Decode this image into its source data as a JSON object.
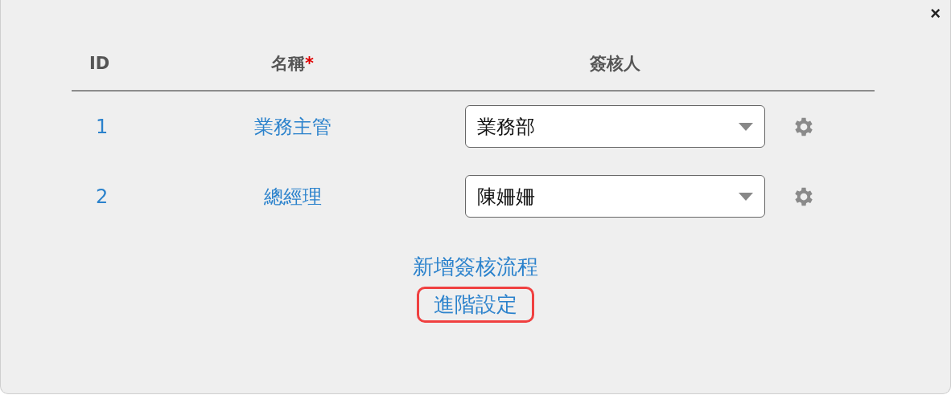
{
  "dialog": {
    "close": "×"
  },
  "table": {
    "columns": [
      {
        "label": "ID"
      },
      {
        "label": "名稱",
        "required_mark": "*"
      },
      {
        "label": "簽核人"
      }
    ],
    "rows": [
      {
        "id": "1",
        "name": "業務主管",
        "approver": "業務部"
      },
      {
        "id": "2",
        "name": "總經理",
        "approver": "陳姍姍"
      }
    ]
  },
  "links": [
    {
      "label": "新增簽核流程",
      "highlighted": false
    },
    {
      "label": "進階設定",
      "highlighted": true
    }
  ]
}
